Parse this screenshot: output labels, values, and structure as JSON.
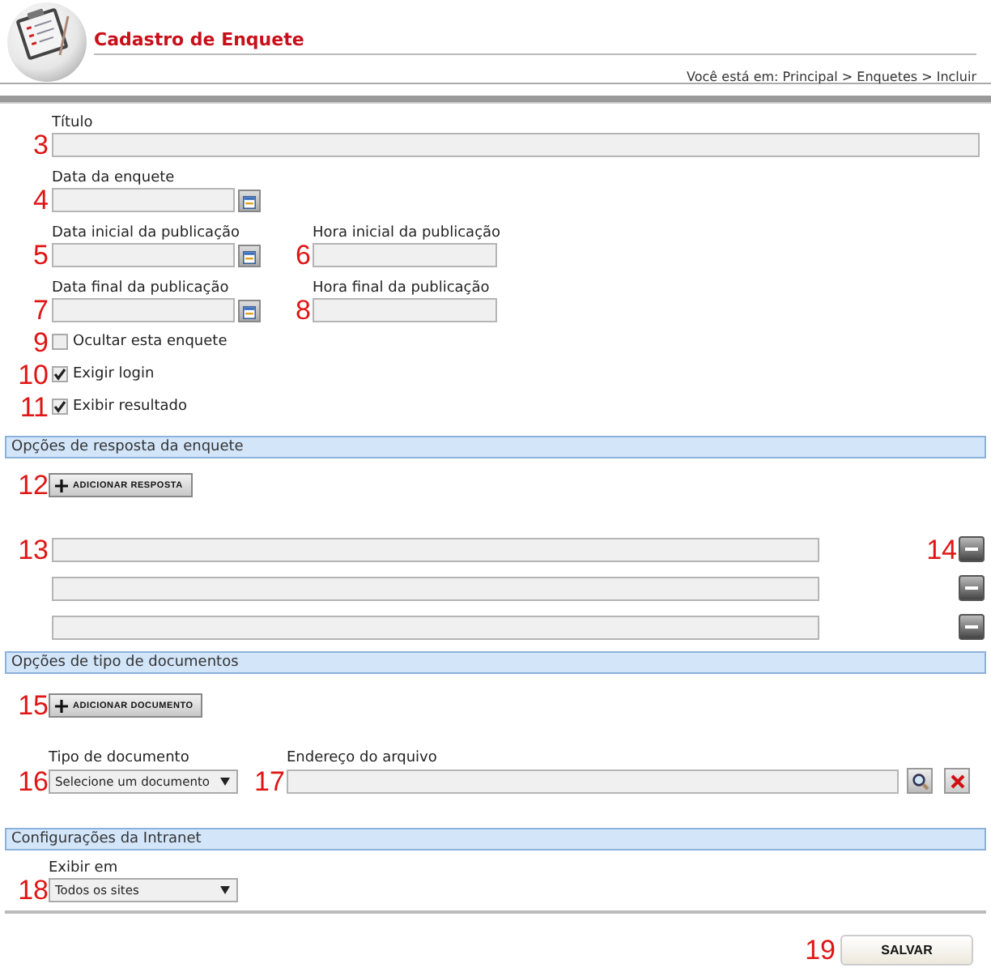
{
  "header": {
    "title": "Cadastro de Enquete",
    "breadcrumb": "Você está em: Principal > Enquetes > Incluir"
  },
  "general": {
    "title_field": {
      "marker": "3",
      "label": "Título"
    },
    "rows": [
      [
        {
          "kind": "date",
          "marker": "4",
          "label": "Data da enquete"
        }
      ],
      [
        {
          "kind": "date",
          "marker": "5",
          "label": "Data inicial da publicação"
        },
        {
          "kind": "text",
          "marker": "6",
          "label": "Hora inicial da publicação"
        }
      ],
      [
        {
          "kind": "date",
          "marker": "7",
          "label": "Data final da publicação"
        },
        {
          "kind": "text",
          "marker": "8",
          "label": "Hora final da publicação"
        }
      ]
    ],
    "checkboxes": [
      {
        "marker": "9",
        "label": "Ocultar esta enquete",
        "checked": false
      },
      {
        "marker": "10",
        "label": "Exigir login",
        "checked": true
      },
      {
        "marker": "11",
        "label": "Exibir resultado",
        "checked": true
      }
    ]
  },
  "answers": {
    "heading": "Opções de resposta da enquete",
    "add_button": {
      "marker": "12",
      "label": "ADICIONAR RESPOSTA"
    },
    "rows": [
      {
        "marker": "13",
        "remove_marker": "14"
      },
      {},
      {}
    ]
  },
  "documents": {
    "heading": "Opções de tipo de documentos",
    "add_button": {
      "marker": "15",
      "label": "ADICIONAR DOCUMENTO"
    },
    "type_select": {
      "marker": "16",
      "label": "Tipo de documento",
      "value": "Selecione um documento"
    },
    "file_field": {
      "marker": "17",
      "label": "Endereço do arquivo"
    }
  },
  "intranet": {
    "heading": "Configurações da Intranet",
    "select": {
      "marker": "18",
      "label": "Exibir em",
      "value": "Todos os sites"
    }
  },
  "save_button": {
    "marker": "19",
    "label": "SALVAR"
  }
}
